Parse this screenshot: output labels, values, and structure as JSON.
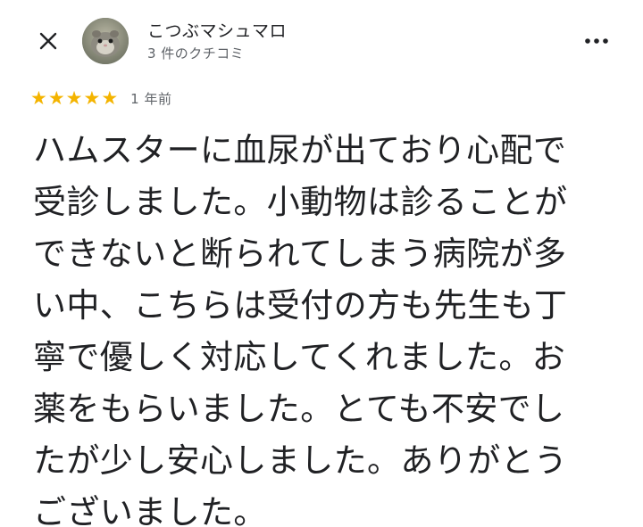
{
  "header": {
    "author_name": "こつぶマシュマロ",
    "review_count": "3 件のクチコミ"
  },
  "icons": {
    "close": "close-icon",
    "more": "more-vert-icon",
    "avatar": "hamster-avatar-photo",
    "star": "star-icon"
  },
  "colors": {
    "star": "#f4b400",
    "text_primary": "#202124",
    "text_secondary": "#5f6368"
  },
  "review": {
    "rating": 5,
    "date": "1 年前",
    "lines": [
      "ハムスターに血尿が出ており心配で",
      "受診しました。小動物は診ることが",
      "できないと断られてしまう病院が多",
      "い中、こちらは受付の方も先生も丁",
      "寧で優しく対応してくれました。お",
      "薬をもらいました。とても不安でし",
      "たが少し安心しました。ありがとう",
      "ございました。"
    ]
  }
}
